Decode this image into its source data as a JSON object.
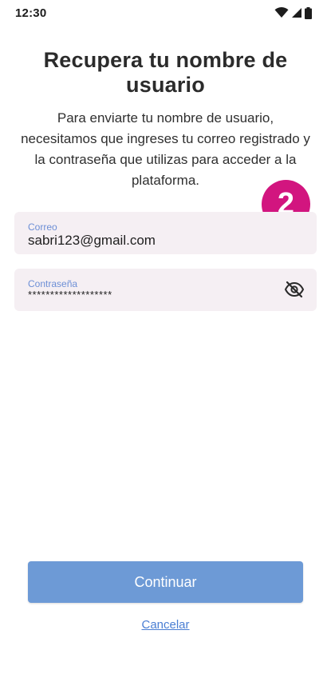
{
  "status_bar": {
    "time": "12:30",
    "icons": [
      "wifi-icon",
      "signal-icon",
      "battery-icon"
    ]
  },
  "header": {
    "title": "Recupera tu nombre de usuario",
    "subtitle": "Para enviarte tu nombre de usuario, necesitamos que ingreses tu correo registrado y la contraseña que utilizas para acceder a la plataforma."
  },
  "step_badge": {
    "label": "2",
    "color": "#d2157f"
  },
  "form": {
    "email": {
      "label": "Correo",
      "value": "sabri123@gmail.com"
    },
    "password": {
      "label": "Contraseña",
      "value": "*******************",
      "toggle_icon": "eye-off-icon"
    }
  },
  "actions": {
    "continue_label": "Continuar",
    "cancel_label": "Cancelar"
  },
  "colors": {
    "accent_button": "#6d9ad6",
    "link": "#4a7ed3",
    "field_background": "#f5eff3",
    "field_label": "#6d8fd6"
  }
}
